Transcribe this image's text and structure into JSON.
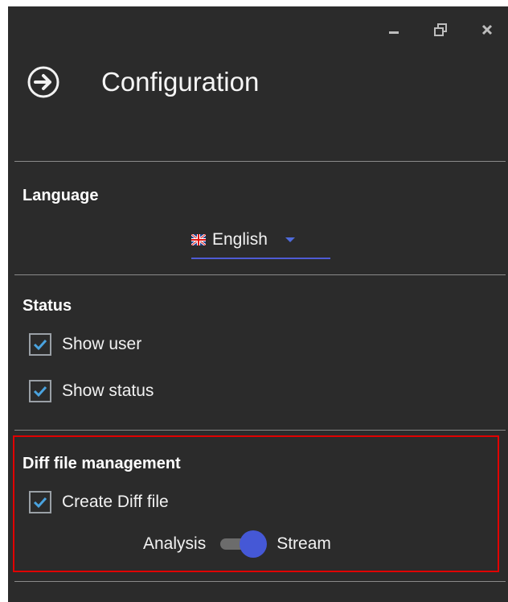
{
  "window": {
    "title": "Configuration",
    "controls": {
      "minimize_icon": "minimize-icon",
      "restore_icon": "restore-icon",
      "close_icon": "close-icon"
    }
  },
  "language": {
    "title": "Language",
    "selected": "English",
    "flag_icon": "uk-flag-icon",
    "accent": "#4f5bd5"
  },
  "status": {
    "title": "Status",
    "items": [
      {
        "label": "Show user",
        "checked": true
      },
      {
        "label": "Show status",
        "checked": true
      }
    ]
  },
  "diff": {
    "title": "Diff file management",
    "create_label": "Create Diff file",
    "create_checked": true,
    "toggle_left": "Analysis",
    "toggle_right": "Stream",
    "toggle_state": "Stream",
    "highlight_color": "#e00000"
  },
  "colors": {
    "background": "#2b2b2b",
    "accent": "#4558d6",
    "check": "#4aa3df"
  }
}
